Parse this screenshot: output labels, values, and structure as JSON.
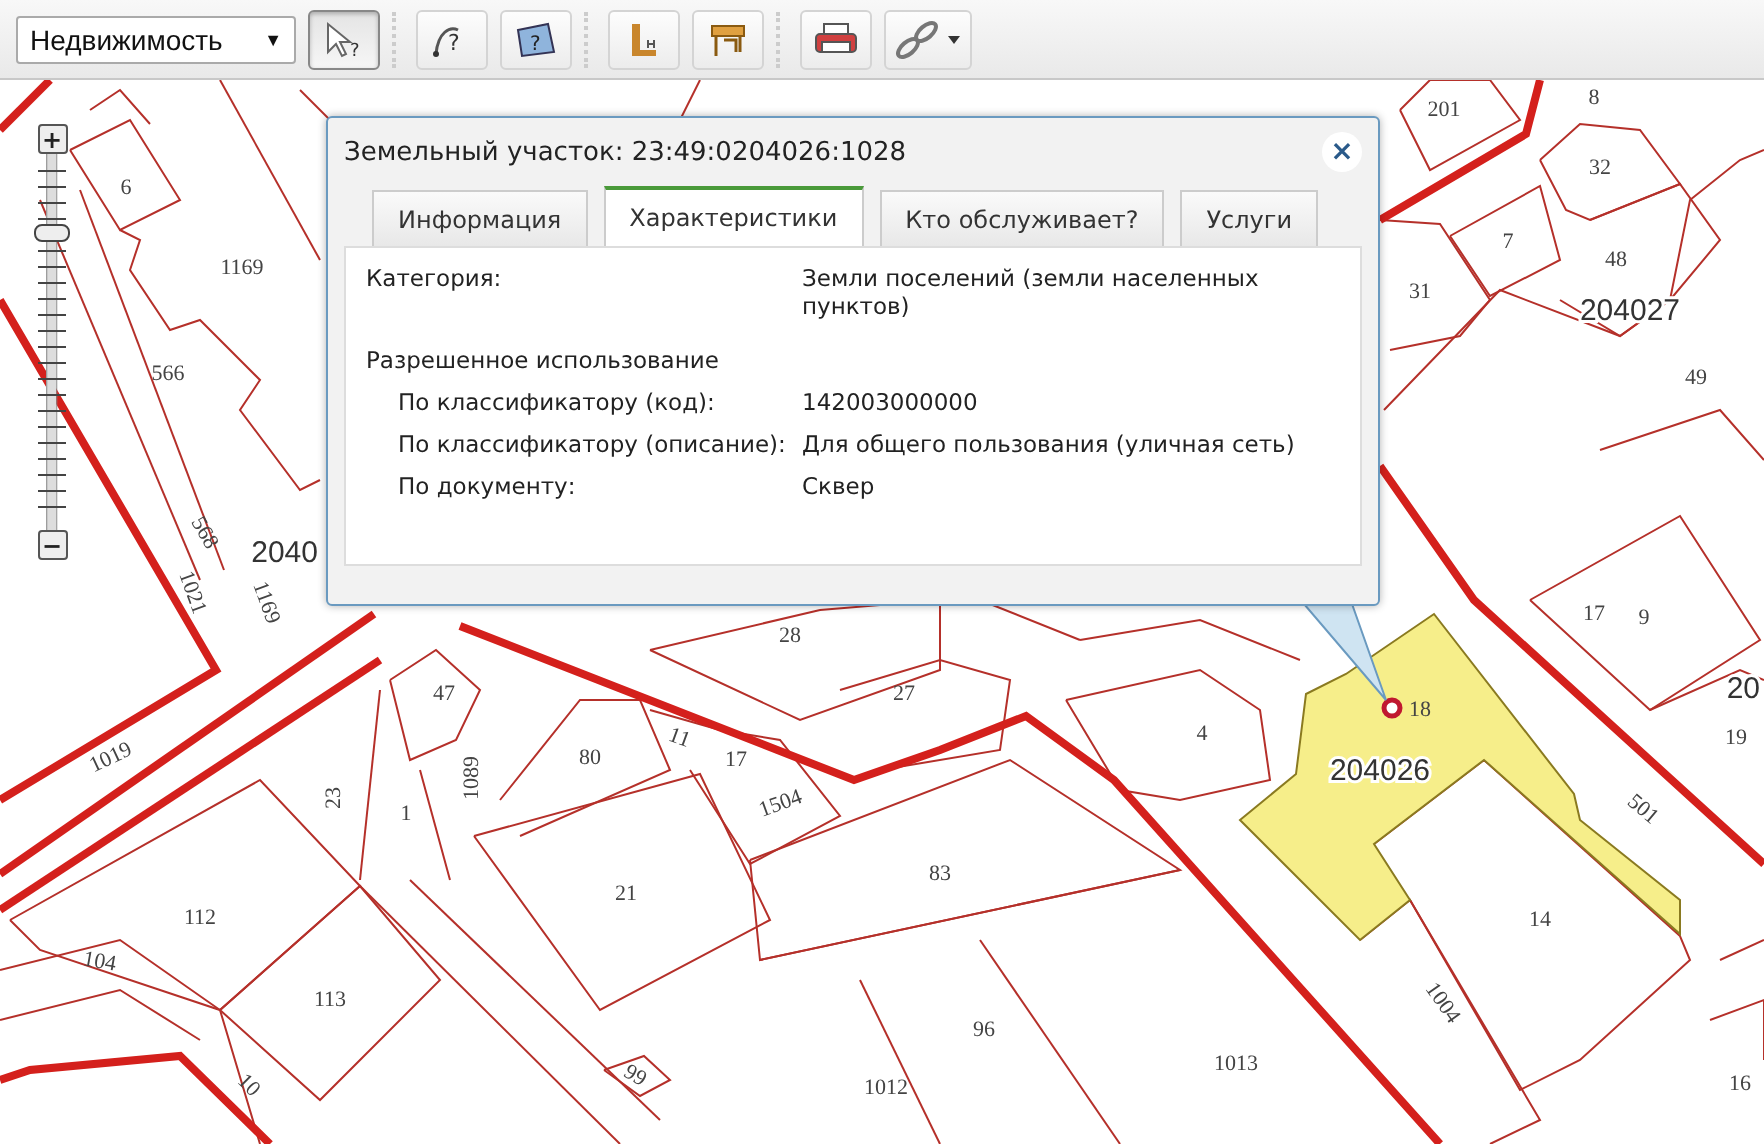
{
  "toolbar": {
    "layer_select": {
      "value": "Недвижимость",
      "caret": "▼"
    },
    "tools": [
      {
        "kind": "identify-point",
        "selected": true,
        "glyph": "?"
      },
      {
        "kind": "identify-line",
        "selected": false,
        "glyph": "?"
      },
      {
        "kind": "identify-area",
        "selected": false,
        "glyph": "?"
      },
      {
        "kind": "measure",
        "selected": false
      },
      {
        "kind": "layers",
        "selected": false
      },
      {
        "kind": "print",
        "selected": false
      },
      {
        "kind": "link",
        "selected": false
      }
    ]
  },
  "zoom_control": {
    "plus": "+",
    "minus": "−",
    "level": 0.8
  },
  "map": {
    "labels": [
      {
        "kind": "parcel",
        "text": "6"
      },
      {
        "kind": "parcel",
        "text": "1169"
      },
      {
        "kind": "parcel",
        "text": "566"
      },
      {
        "kind": "parcel",
        "text": "568"
      },
      {
        "kind": "parcel",
        "text": "1021"
      },
      {
        "kind": "parcel",
        "text": "1169"
      },
      {
        "kind": "block",
        "text": "2040"
      },
      {
        "kind": "parcel",
        "text": "201"
      },
      {
        "kind": "parcel",
        "text": "8"
      },
      {
        "kind": "parcel",
        "text": "32"
      },
      {
        "kind": "parcel",
        "text": "7"
      },
      {
        "kind": "parcel",
        "text": "48"
      },
      {
        "kind": "block",
        "text": "204027"
      },
      {
        "kind": "parcel",
        "text": "31"
      },
      {
        "kind": "parcel",
        "text": "49"
      },
      {
        "kind": "parcel",
        "text": "17"
      },
      {
        "kind": "parcel",
        "text": "9"
      },
      {
        "kind": "block",
        "text": "20"
      },
      {
        "kind": "parcel",
        "text": "19"
      },
      {
        "kind": "parcel",
        "text": "28"
      },
      {
        "kind": "parcel",
        "text": "27"
      },
      {
        "kind": "parcel",
        "text": "4"
      },
      {
        "kind": "parcel",
        "text": "18"
      },
      {
        "kind": "block",
        "text": "204026"
      },
      {
        "kind": "parcel",
        "text": "501"
      },
      {
        "kind": "parcel",
        "text": "14"
      },
      {
        "kind": "parcel",
        "text": "1004"
      },
      {
        "kind": "parcel",
        "text": "16"
      },
      {
        "kind": "parcel",
        "text": "1013"
      },
      {
        "kind": "parcel",
        "text": "96"
      },
      {
        "kind": "parcel",
        "text": "1012"
      },
      {
        "kind": "parcel",
        "text": "83"
      },
      {
        "kind": "parcel",
        "text": "21"
      },
      {
        "kind": "parcel",
        "text": "80"
      },
      {
        "kind": "parcel",
        "text": "11"
      },
      {
        "kind": "parcel",
        "text": "17"
      },
      {
        "kind": "parcel",
        "text": "1504"
      },
      {
        "kind": "parcel",
        "text": "47"
      },
      {
        "kind": "parcel",
        "text": "1089"
      },
      {
        "kind": "parcel",
        "text": "1"
      },
      {
        "kind": "parcel",
        "text": "23"
      },
      {
        "kind": "parcel",
        "text": "1019"
      },
      {
        "kind": "parcel",
        "text": "112"
      },
      {
        "kind": "parcel",
        "text": "104"
      },
      {
        "kind": "parcel",
        "text": "113"
      },
      {
        "kind": "parcel",
        "text": "10"
      },
      {
        "kind": "parcel",
        "text": "99"
      }
    ]
  },
  "popup": {
    "title": "Земельный участок: 23:49:0204026:1028",
    "close": "×",
    "tabs": [
      {
        "label": "Информация",
        "selected": false
      },
      {
        "label": "Характеристики",
        "selected": true
      },
      {
        "label": "Кто обслуживает?",
        "selected": false
      },
      {
        "label": "Услуги",
        "selected": false
      }
    ],
    "fields": [
      {
        "kind": "row",
        "label": "Категория:",
        "value": "Земли поселений (земли населенных пунктов)"
      },
      {
        "kind": "heading",
        "label": "Разрешенное использование"
      },
      {
        "kind": "subrow",
        "label": "По классификатору (код):",
        "value": "142003000000"
      },
      {
        "kind": "subrow",
        "label": "По классификатору (описание):",
        "value": "Для общего пользования (уличная сеть)"
      },
      {
        "kind": "subrow",
        "label": "По документу:",
        "value": "Сквер"
      }
    ]
  }
}
